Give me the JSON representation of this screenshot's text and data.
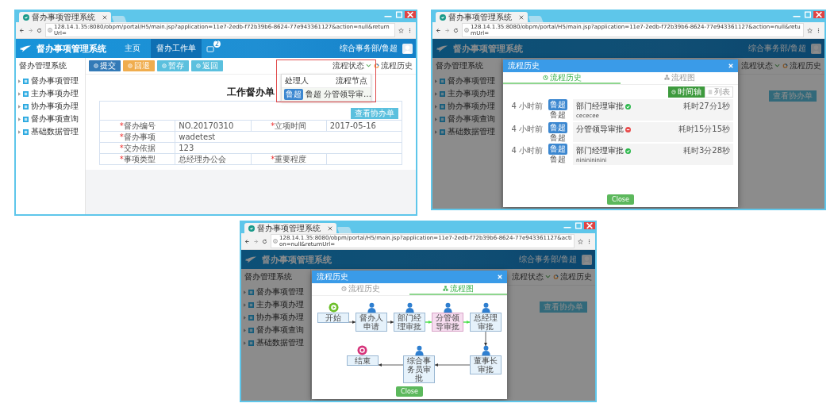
{
  "panels": [
    {
      "kind": "form",
      "browser": {
        "tab_title": "督办事项管理系统",
        "url": "128.14.1.35:8080/obpm/portal/H5/main.jsp?application=11e7-2edb-f72b39b6-8624-77e943361127&action=null&returnUrl="
      },
      "header": {
        "title": "督办事项管理系统",
        "nav": [
          {
            "label": "主页",
            "selected": false
          },
          {
            "label": "督办工作单",
            "selected": true
          }
        ],
        "notification_count": "2",
        "user": "综合事务部/鲁超"
      },
      "sidebar": {
        "title": "督办管理系统",
        "items": [
          "督办事项管理",
          "主办事项办理",
          "协办事项办理",
          "督办事项查询",
          "基础数据管理"
        ]
      },
      "toolbar": {
        "buttons": [
          {
            "label": "提交",
            "kind": "primary"
          },
          {
            "label": "回退",
            "kind": "warning"
          },
          {
            "label": "暂存",
            "kind": "info"
          },
          {
            "label": "返回",
            "kind": "info"
          }
        ],
        "status_menu": "流程状态",
        "history_link": "流程历史"
      },
      "status_dropdown": {
        "columns": [
          "处理人",
          "流程节点"
        ],
        "rows": [
          {
            "avatar": "鲁超",
            "handler": "鲁超",
            "node": "分管领导审…"
          }
        ]
      },
      "form": {
        "title": "工作督办单",
        "view_button": "查看协办单",
        "rows": [
          [
            {
              "mark": "*",
              "label": "督办编号",
              "value": "NO.20170310"
            },
            {
              "mark": "*",
              "label": "立项时间",
              "value": "2017-05-16"
            }
          ],
          [
            {
              "mark": "*",
              "label": "督办事项",
              "value": "wadetest"
            }
          ],
          [
            {
              "mark": "*",
              "label": "交办依据",
              "value": "123"
            }
          ],
          [
            {
              "mark": "*",
              "label": "事项类型",
              "value": "总经理办公会"
            },
            {
              "mark": "*",
              "label": "重要程度"
            }
          ]
        ]
      }
    },
    {
      "kind": "history",
      "browser": {
        "tab_title": "督办事项管理系统",
        "url": "128.14.1.35:8080/obpm/portal/H5/main.jsp?application=11e7-2edb-f72b39b6-8624-77e943361127&action=null&returnUrl="
      },
      "header": {
        "title": "督办事项管理系统",
        "user": "综合事务部/鲁超"
      },
      "sidebar": {
        "title": "督办管理系统",
        "items": [
          "督办事项管理",
          "主办事项办理",
          "协办事项办理",
          "督办事项查询",
          "基础数据管理"
        ]
      },
      "toolbar": {
        "status_menu": "流程状态",
        "history_link": "流程历史"
      },
      "view_button": "查看协办单",
      "modal": {
        "title": "流程历史",
        "tabs": [
          {
            "label": "流程历史",
            "kind": "history",
            "selected": true
          },
          {
            "label": "流程图",
            "kind": "diagram",
            "selected": false
          }
        ],
        "views": [
          {
            "label": "时间轴",
            "kind": "timeline",
            "selected": true
          },
          {
            "label": "列表",
            "kind": "list",
            "selected": false
          }
        ],
        "entries": [
          {
            "time": "4 小时前",
            "avatar": "鲁超",
            "user": "鲁超",
            "node": "部门经理审批",
            "approved": true,
            "duration": "耗时27分1秒",
            "comment": "cececee"
          },
          {
            "time": "4 小时前",
            "avatar": "鲁超",
            "user": "鲁超",
            "node": "分管领导审批",
            "approved": false,
            "duration": "耗时15分15秒"
          },
          {
            "time": "4 小时前",
            "avatar": "鲁超",
            "user": "鲁超",
            "node": "部门经理审批",
            "approved": true,
            "duration": "耗时3分28秒",
            "comment": "nininininini"
          }
        ],
        "close": "Close"
      }
    },
    {
      "kind": "diagram",
      "browser": {
        "tab_title": "督办事项管理系统",
        "url": "128.14.1.35:8080/obpm/portal/H5/main.jsp?application=11e7-2edb-f72b39b6-8624-77e943361127&action=null&returnUrl="
      },
      "header": {
        "title": "督办事项管理系统",
        "user": "综合事务部/鲁超"
      },
      "sidebar": {
        "title": "督办管理系统",
        "items": [
          "督办事项管理",
          "主办事项办理",
          "协办事项办理",
          "督办事项查询",
          "基础数据管理"
        ]
      },
      "toolbar": {
        "status_menu": "流程状态",
        "history_link": "流程历史"
      },
      "view_button": "查看协办单",
      "modal": {
        "title": "流程历史",
        "tabs": [
          {
            "label": "流程历史",
            "kind": "history",
            "selected": false
          },
          {
            "label": "流程图",
            "kind": "diagram",
            "selected": true
          }
        ],
        "diagram": {
          "rows": [
            {
              "nodes": [
                {
                  "label": "开始",
                  "kind": "start",
                  "current": false
                },
                {
                  "label": "督办人申请",
                  "kind": "task",
                  "current": false
                },
                {
                  "label": "部门经理审批",
                  "kind": "task",
                  "current": false
                },
                {
                  "label": "分管领导审批",
                  "kind": "task",
                  "current": true
                },
                {
                  "label": "总经理审批",
                  "kind": "task",
                  "current": false
                }
              ]
            },
            {
              "nodes": [
                {
                  "label": "结束",
                  "kind": "end",
                  "current": false
                },
                {
                  "label": "综合事务员审批",
                  "kind": "task",
                  "current": false
                },
                {
                  "label": "董事长审批",
                  "kind": "task",
                  "current": false
                }
              ]
            }
          ],
          "edges": [
            {
              "passed": false
            },
            {
              "passed": false
            },
            {
              "passed": true
            },
            {
              "passed": true
            },
            {
              "passed": false
            },
            {
              "passed": false
            },
            {
              "passed": false
            }
          ]
        },
        "close": "Close"
      }
    }
  ]
}
